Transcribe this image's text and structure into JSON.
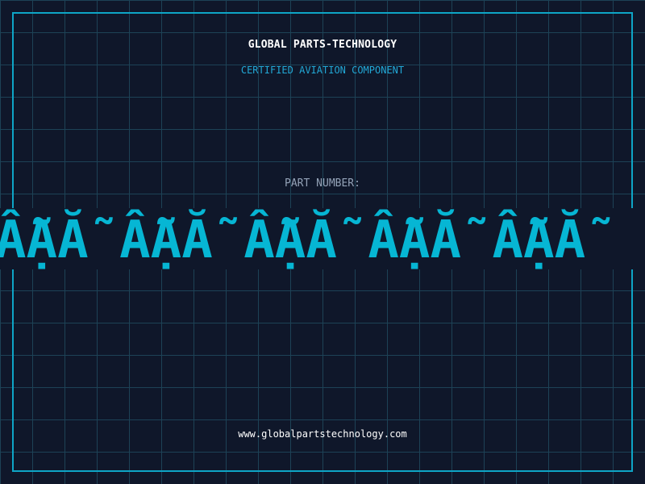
{
  "header": {
    "company": "GLOBAL PARTS-TECHNOLOGY",
    "subtitle": "CERTIFIED AVIATION COMPONENT"
  },
  "part": {
    "label": "PART NUMBER:",
    "value": "ẪẠẴ ẪẠẴ ẪẠẴ ẪẠẴ ẪẠẴ"
  },
  "footer": {
    "website": "www.globalpartstechnology.com"
  },
  "colors": {
    "background": "#0f172a",
    "grid": "#1d4256",
    "frame": "#0ea5c6",
    "accent": "#06b6d4",
    "subtitle": "#22a8d6",
    "label": "#94a3b8"
  }
}
